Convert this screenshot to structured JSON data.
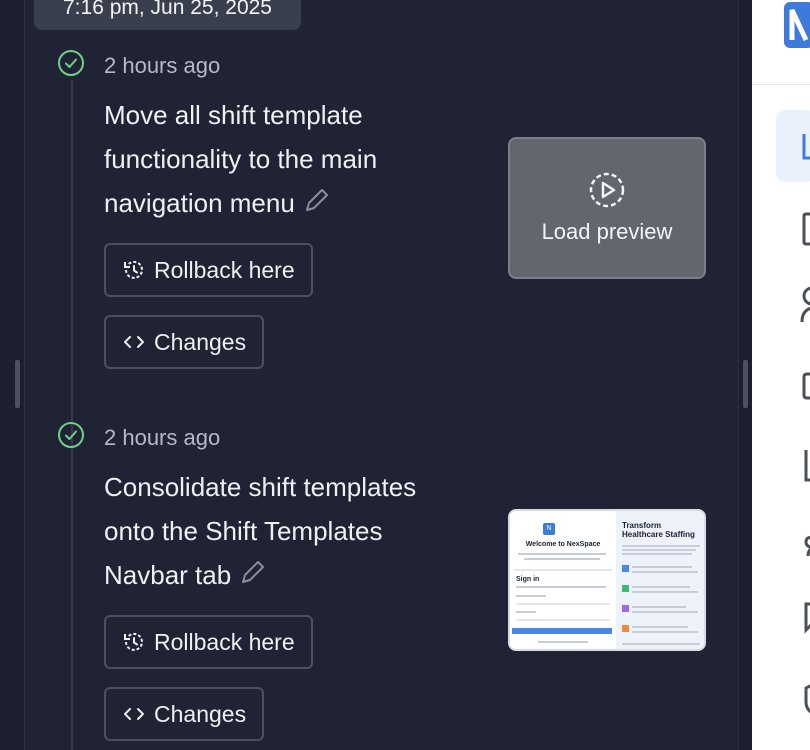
{
  "tooltip": {
    "timestamp": "7:16 pm, Jun 25, 2025"
  },
  "history": [
    {
      "time": "2 hours ago",
      "title": "Move all shift template functionality to the main navigation menu",
      "rollback_label": "Rollback here",
      "changes_label": "Changes",
      "preview_label": "Load preview",
      "status_icon": "check-circle-icon"
    },
    {
      "time": "2 hours ago",
      "title": "Consolidate shift templates onto the Shift Templates Navbar tab",
      "rollback_label": "Rollback here",
      "changes_label": "Changes",
      "status_icon": "check-circle-icon",
      "thumbnail": {
        "left_title": "Welcome to NexSpace",
        "right_title": "Transform Healthcare Staffing",
        "sign_in": "Sign in"
      }
    }
  ],
  "colors": {
    "background": "#1f2333",
    "success": "#6fcf8b",
    "accent": "#3c7bdc"
  }
}
